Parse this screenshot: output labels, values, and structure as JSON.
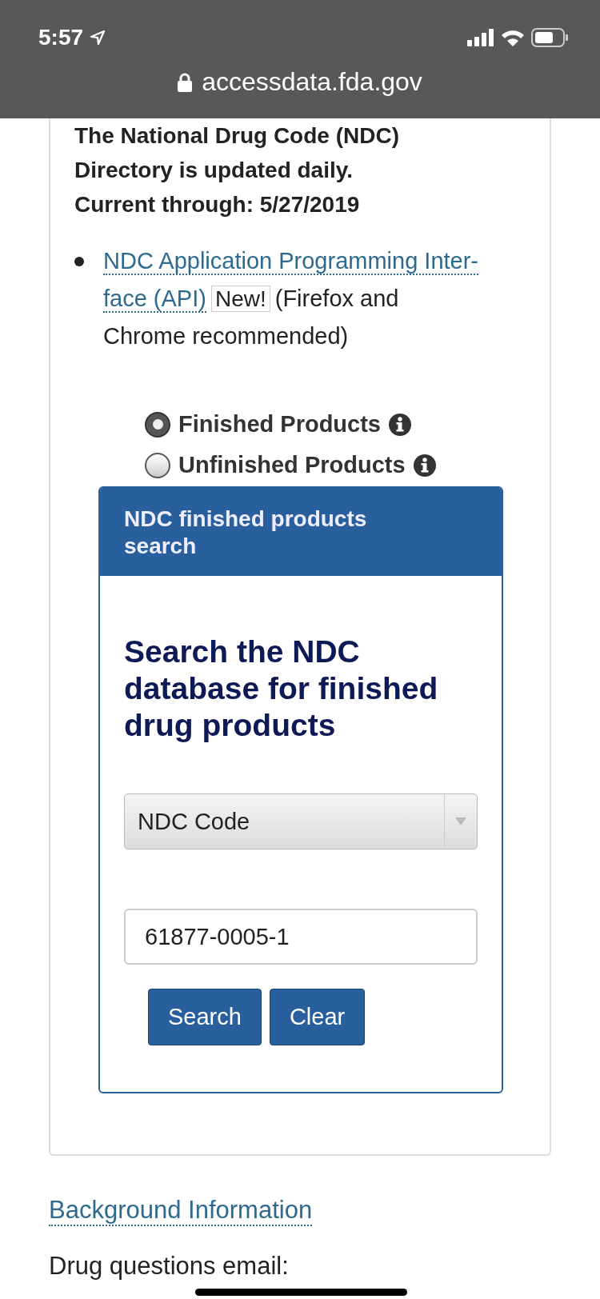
{
  "status_bar": {
    "time": "5:57"
  },
  "address_bar": {
    "url": "accessdata.fda.gov"
  },
  "intro": [
    "The National Drug Code (NDC)",
    "Directory is updated daily.",
    "Current through: 5/27/2019"
  ],
  "links": [
    {
      "link_lines": [
        "NDC Application Programming Inter-",
        "face (API)"
      ],
      "badge": "New!",
      "note_lines": [
        "(Firefox and",
        "Chrome recommended)"
      ]
    }
  ],
  "product_types": [
    {
      "label": "Finished Products",
      "selected": true
    },
    {
      "label": "Unfinished Products",
      "selected": false
    }
  ],
  "search_panel": {
    "title": "NDC finished products search",
    "heading": "Search the NDC database for finished drug products",
    "search_by": "NDC Code",
    "query": "61877-0005-1",
    "buttons": [
      "Search",
      "Clear"
    ]
  },
  "background_link": "Background Information",
  "footer_text": "Drug questions email:"
}
